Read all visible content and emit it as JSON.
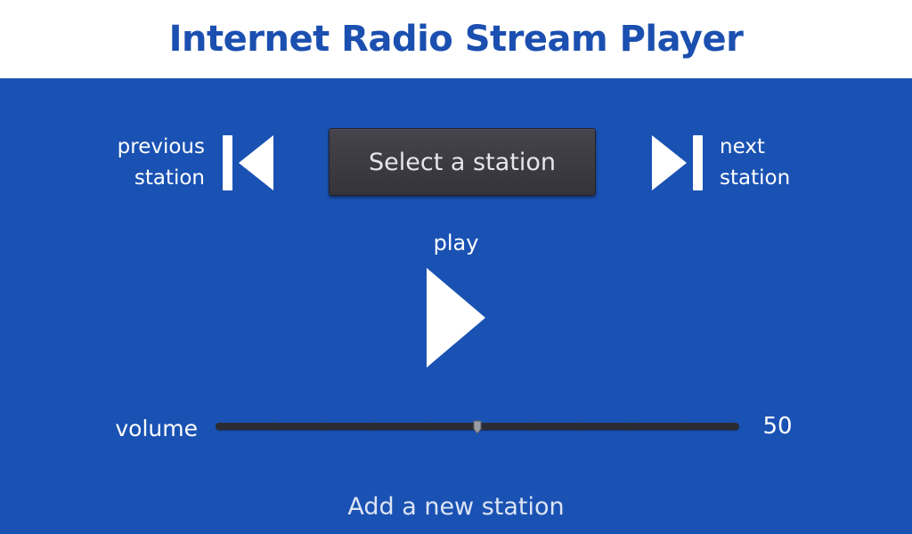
{
  "header": {
    "title": "Internet Radio Stream Player"
  },
  "controls": {
    "previous_label_line1": "previous",
    "previous_label_line2": "station",
    "next_label_line1": "next",
    "next_label_line2": "station",
    "station_select": "Select a station",
    "play_label": "play",
    "prev_icon": "skip-previous-icon",
    "next_icon": "skip-next-icon",
    "play_icon": "play-icon"
  },
  "volume": {
    "label": "volume",
    "value": "50",
    "level_percent": 50,
    "min": 0,
    "max": 100
  },
  "footer": {
    "add_station": "Add a new station"
  },
  "colors": {
    "background": "#1a52b3",
    "header_bg": "#ffffff",
    "title": "#1b4fb0",
    "button_bg": "#3e3d44",
    "track": "#2b2c33"
  }
}
